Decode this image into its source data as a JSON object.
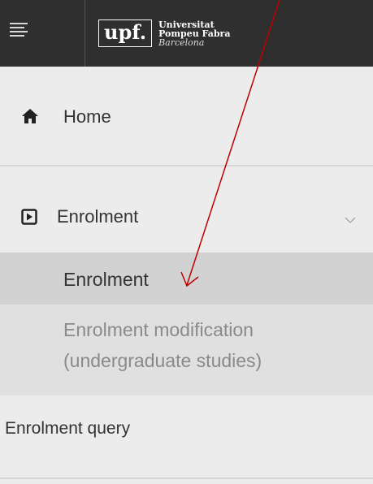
{
  "header": {
    "logo_mark": "upf.",
    "logo_line1": "Universitat",
    "logo_line2": "Pompeu Fabra",
    "logo_line3": "Barcelona"
  },
  "nav": {
    "home_label": "Home",
    "enrolment_label": "Enrolment",
    "sub_items": {
      "enrolment": "Enrolment",
      "modification_line1": "Enrolment modification",
      "modification_line2": "(undergraduate studies)"
    },
    "query_label": "Enrolment query"
  },
  "colors": {
    "topbar": "#2f2f2f",
    "sidebar": "#ececec",
    "active_item": "#d2d2d2",
    "arrow": "#c00000"
  },
  "icons": [
    "menu-icon",
    "home-icon",
    "play-square-icon",
    "chevron-down-icon"
  ]
}
